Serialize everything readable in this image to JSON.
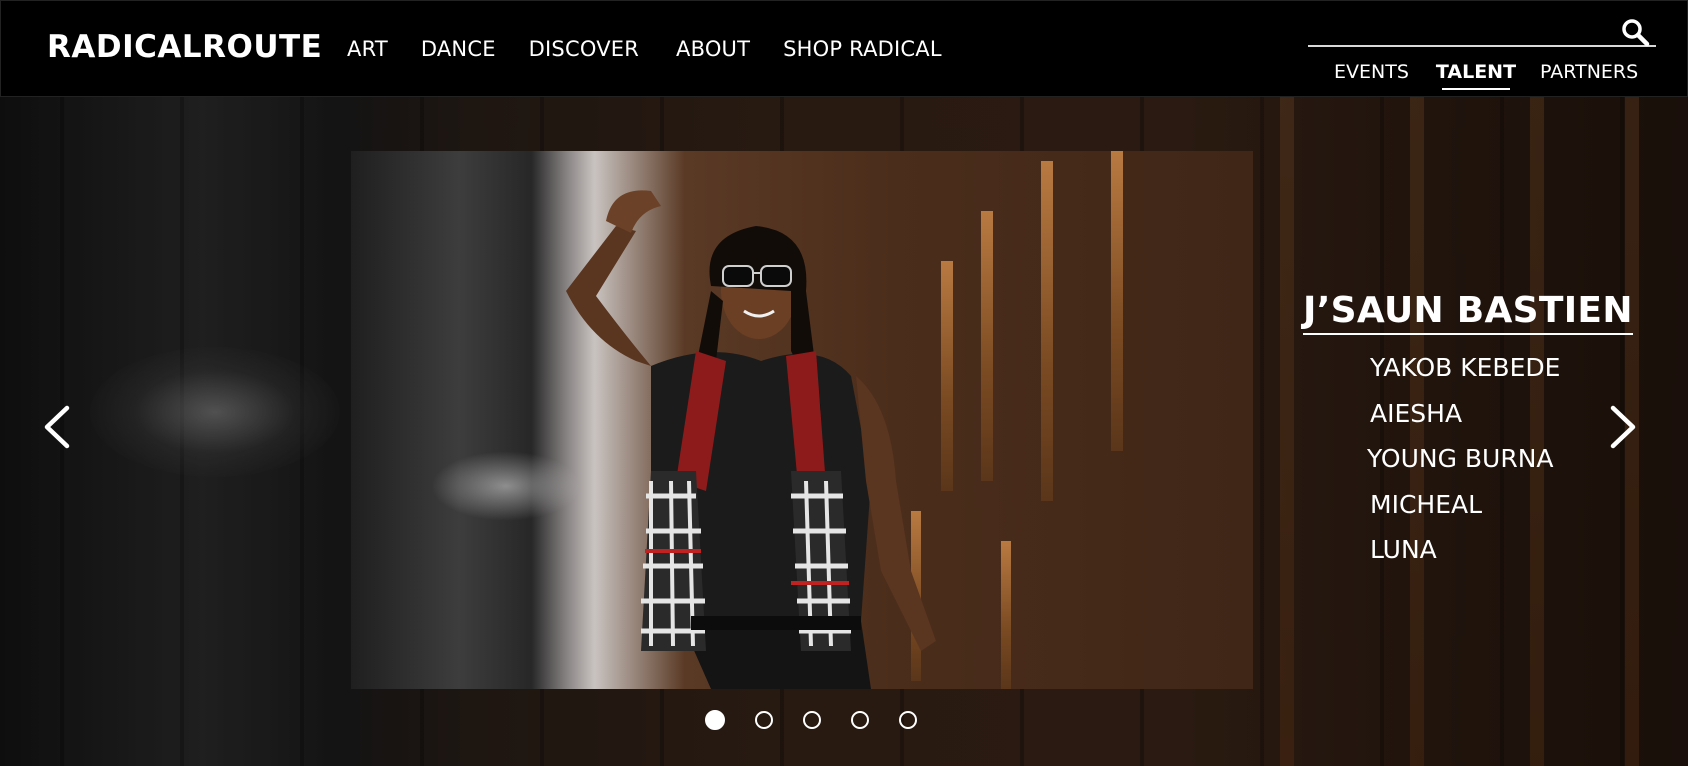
{
  "brand": {
    "name": "RADICALROUTE"
  },
  "main_nav": [
    {
      "label": "ART"
    },
    {
      "label": "DANCE"
    },
    {
      "label": "DISCOVER"
    },
    {
      "label": "ABOUT"
    },
    {
      "label": "SHOP RADICAL"
    }
  ],
  "search": {
    "icon": "search-icon"
  },
  "sub_nav": [
    {
      "label": "EVENTS",
      "active": false
    },
    {
      "label": "TALENT",
      "active": true
    },
    {
      "label": "PARTNERS",
      "active": false
    }
  ],
  "hero": {
    "featured_talent": "J’SAUN BASTIEN",
    "talent_list": [
      {
        "name": "YAKOB KEBEDE"
      },
      {
        "name": "AIESHA"
      },
      {
        "name": "YOUNG BURNA"
      },
      {
        "name": "MICHEAL"
      },
      {
        "name": "LUNA"
      }
    ],
    "prev_icon": "chevron-left-icon",
    "next_icon": "chevron-right-icon",
    "slide_count": 5,
    "active_slide": 1
  },
  "colors": {
    "header_bg": "#000000",
    "text": "#ffffff",
    "accent_line": "#d9d9d9"
  }
}
